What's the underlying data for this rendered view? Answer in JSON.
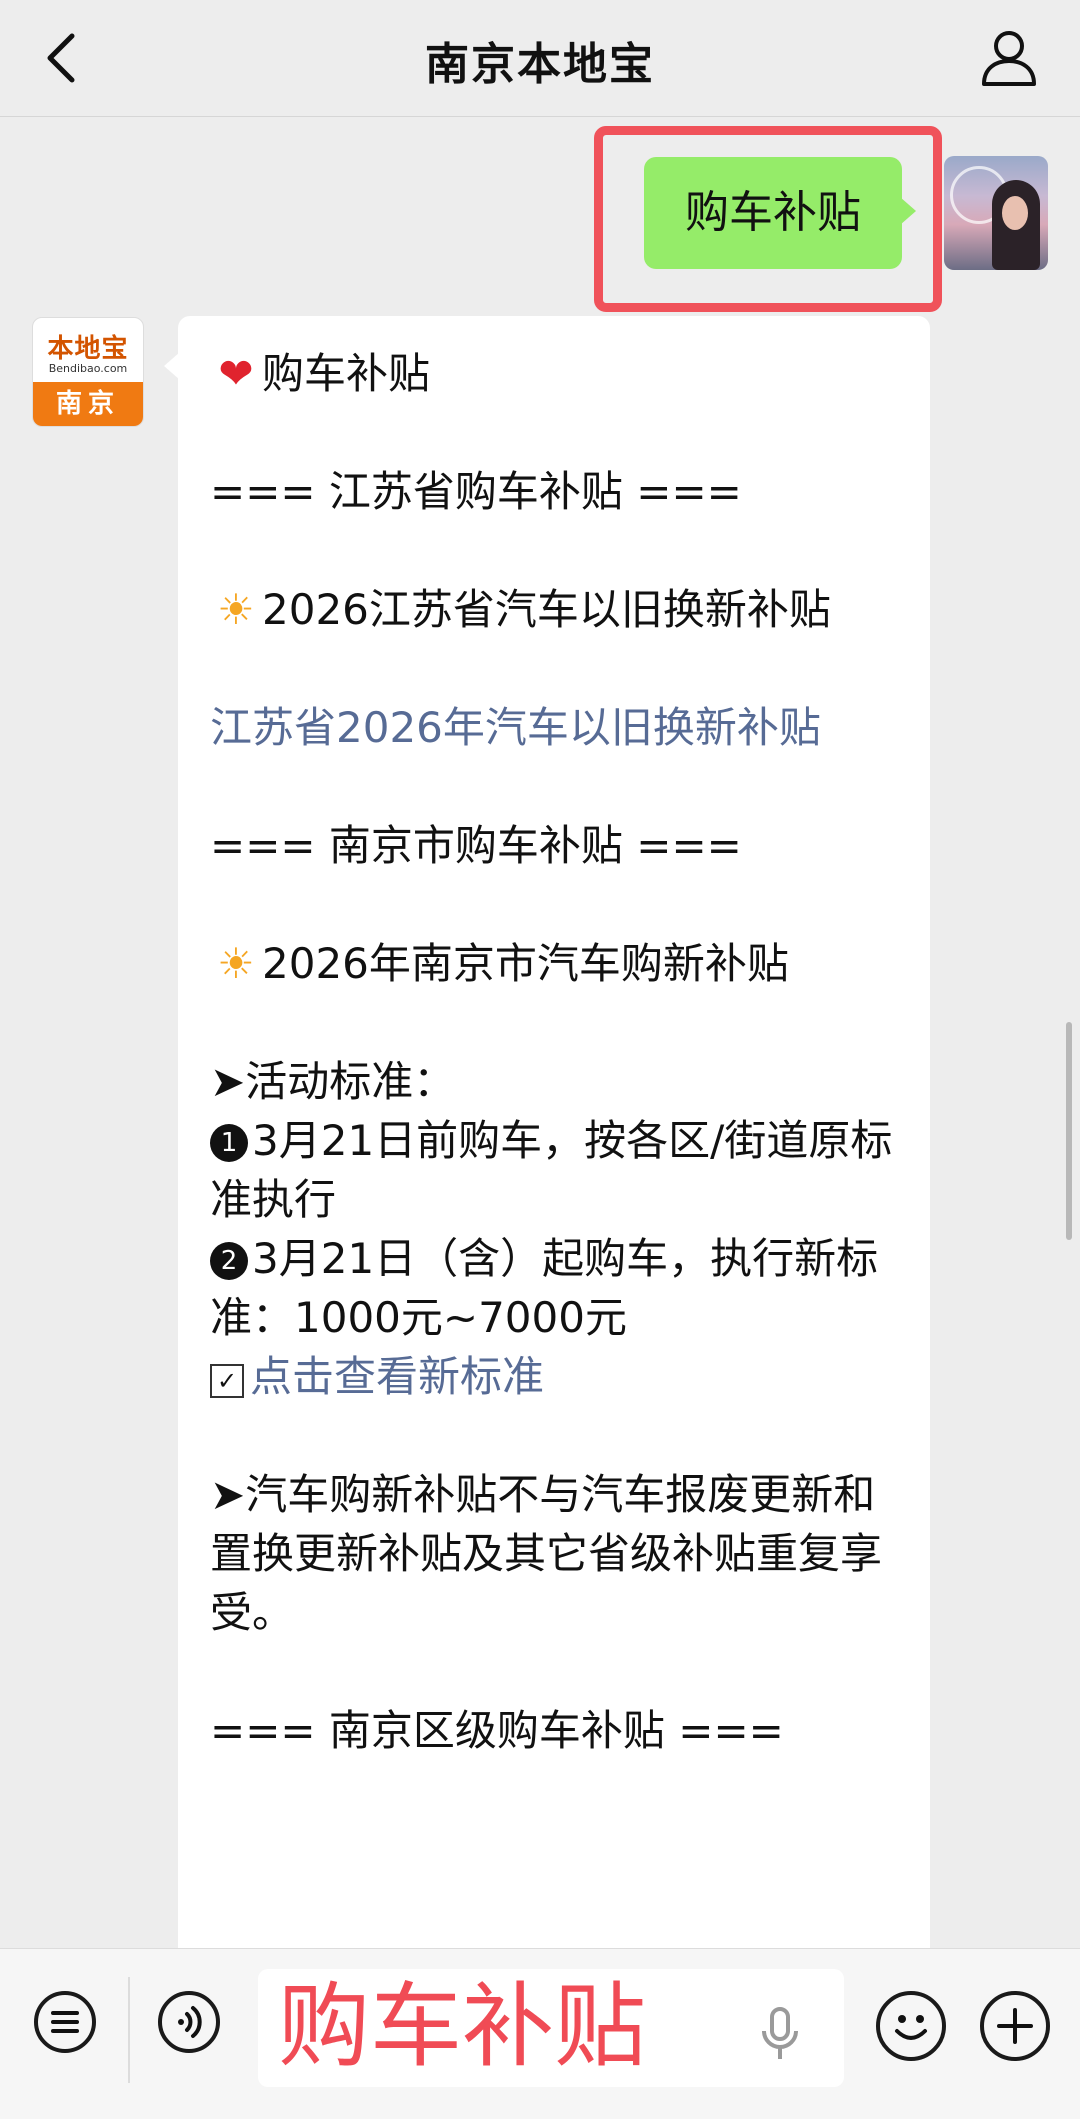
{
  "header": {
    "title": "南京本地宝"
  },
  "outgoing": {
    "text": "购车补贴"
  },
  "official": {
    "avatar_brand": "本地宝",
    "avatar_site": "Bendibao.com",
    "avatar_city": "南京"
  },
  "message": {
    "line_title": "购车补贴",
    "section1": "=== 江苏省购车补贴 ===",
    "item1": "2026江苏省汽车以旧换新补贴",
    "link1": "江苏省2026年汽车以旧换新补贴",
    "section2": "=== 南京市购车补贴 ===",
    "item2": "2026年南京市汽车购新补贴",
    "standard_label": "➤活动标准：",
    "rule1": "3月21日前购车，按各区/街道原标准执行",
    "rule2": "3月21日（含）起购车，执行新标准：1000元~7000元",
    "link2": "点击查看新标准",
    "note": "➤汽车购新补贴不与汽车报废更新和置换更新补贴及其它省级补贴重复享受。",
    "section3": "=== 南京区级购车补贴 ==="
  },
  "input": {
    "value": "购车补贴"
  },
  "icons": {
    "back": "chevron-left-icon",
    "profile": "person-icon",
    "heart": "❤",
    "sun": "☀",
    "num1": "1",
    "num2": "2",
    "check": "☑"
  },
  "colors": {
    "outgoing_bubble": "#95ec69",
    "link": "#576b95",
    "highlight": "#f0525a",
    "input_text": "#f04b55"
  }
}
